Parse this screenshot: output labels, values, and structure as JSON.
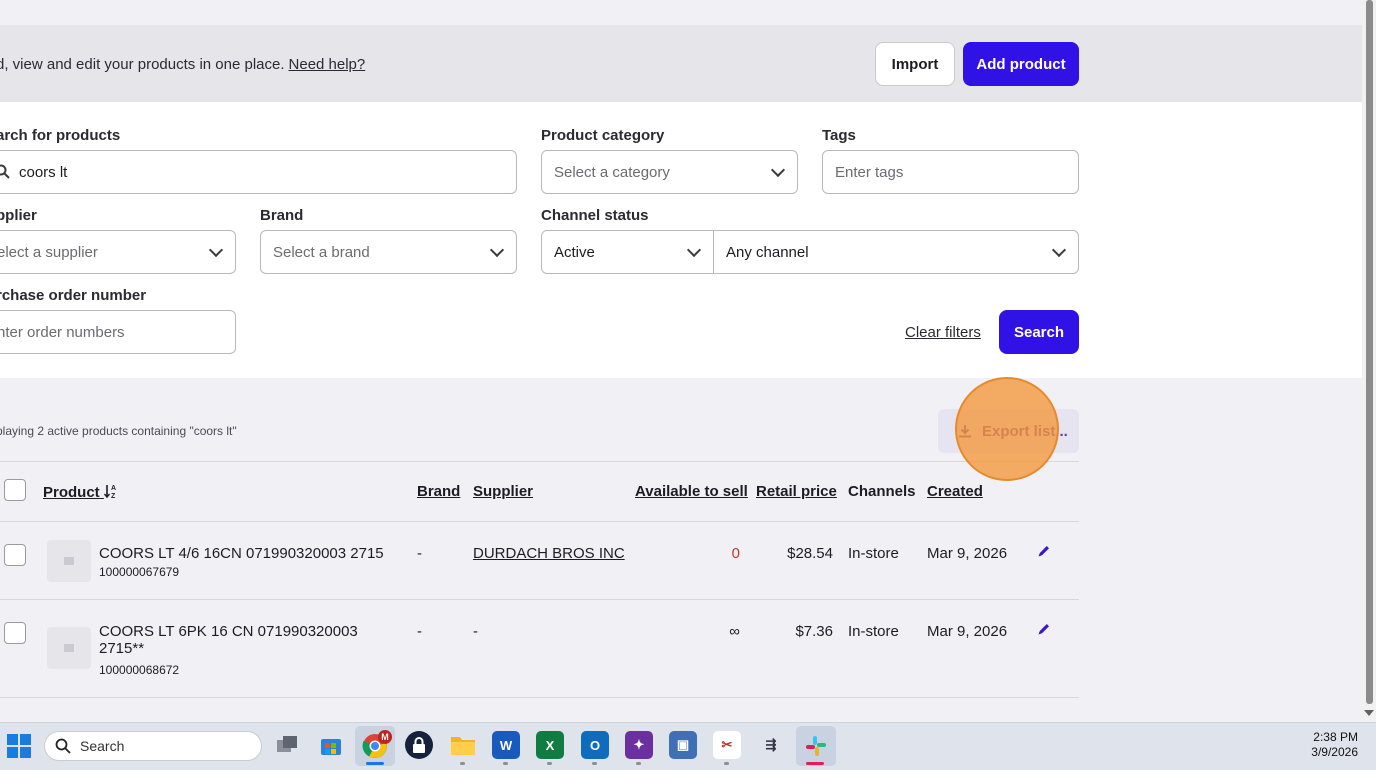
{
  "header": {
    "description": "d, view and edit your products in one place.",
    "help_link": "Need help?",
    "import_label": "Import",
    "add_product_label": "Add product"
  },
  "filters": {
    "search_label": "arch for products",
    "search_value": "coors lt",
    "category_label": "Product category",
    "category_placeholder": "Select a category",
    "tags_label": "Tags",
    "tags_placeholder": "Enter tags",
    "supplier_label": "pplier",
    "supplier_placeholder": "elect a supplier",
    "brand_label": "Brand",
    "brand_placeholder": "Select a brand",
    "channel_status_label": "Channel status",
    "channel_status_value": "Active",
    "channel_value": "Any channel",
    "po_label": "rchase order number",
    "po_placeholder": "nter order numbers",
    "clear_filters_label": "Clear filters",
    "search_button_label": "Search"
  },
  "results": {
    "info": "playing 2 active products containing \"coors lt\"",
    "export_label": "Export list..."
  },
  "table": {
    "headers": {
      "product": "Product",
      "brand": "Brand",
      "supplier": "Supplier",
      "available": "Available to sell",
      "retail": "Retail price",
      "channels": "Channels",
      "created": "Created"
    },
    "rows": [
      {
        "name": "COORS LT 4/6 16CN 071990320003 2715",
        "sku": "100000067679",
        "brand": "-",
        "supplier": "DURDACH BROS INC",
        "available": "0",
        "price": "$28.54",
        "channels": "In-store",
        "created": "Mar 9, 2026"
      },
      {
        "name_line1": "COORS LT 6PK 16 CN 071990320003",
        "name_line2": "2715**",
        "sku": "100000068672",
        "brand": "-",
        "supplier": "-",
        "available": "∞",
        "price": "$7.36",
        "channels": "In-store",
        "created": "Mar 9, 2026"
      }
    ]
  },
  "taskbar": {
    "search_placeholder": "Search",
    "time": "2:38 PM",
    "date": "3/9/2026",
    "gmail_badge": "M"
  },
  "colors": {
    "primary": "#3112e6",
    "highlight": "#f4973a",
    "stock_zero": "#c0392b"
  }
}
